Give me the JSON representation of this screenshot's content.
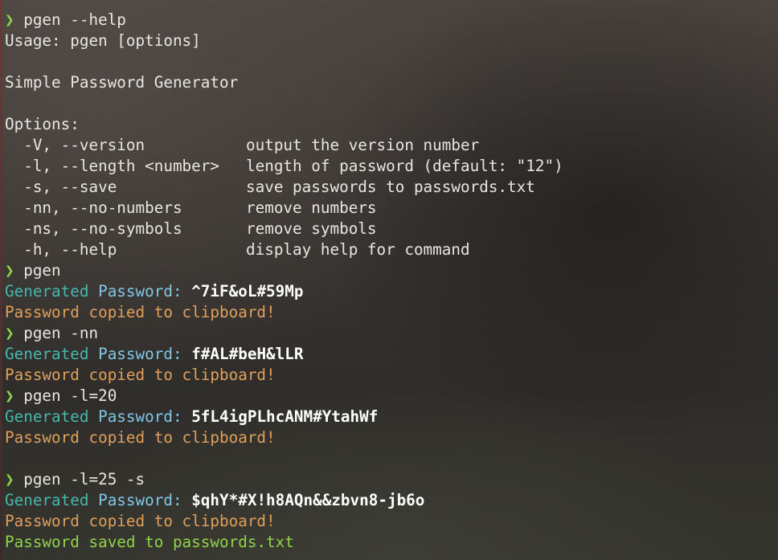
{
  "terminal": {
    "prompt_symbol": "❯",
    "help": {
      "command": "pgen --help",
      "usage": "Usage: pgen [options]",
      "description": "Simple Password Generator",
      "options_header": "Options:",
      "options": [
        {
          "flag": "  -V, --version",
          "desc": "output the version number"
        },
        {
          "flag": "  -l, --length <number>",
          "desc": "length of password (default: \"12\")"
        },
        {
          "flag": "  -s, --save",
          "desc": "save passwords to passwords.txt"
        },
        {
          "flag": "  -nn, --no-numbers",
          "desc": "remove numbers"
        },
        {
          "flag": "  -ns, --no-symbols",
          "desc": "remove symbols"
        },
        {
          "flag": "  -h, --help",
          "desc": "display help for command"
        }
      ]
    },
    "runs": [
      {
        "command": "pgen",
        "generated_label_1": "Generated",
        "generated_label_2": "Password:",
        "password": "^7iF&oL#59Mp",
        "copied": "Password copied to clipboard!"
      },
      {
        "command": "pgen -nn",
        "generated_label_1": "Generated",
        "generated_label_2": "Password:",
        "password": "f#AL#beH&lLR",
        "copied": "Password copied to clipboard!"
      },
      {
        "command": "pgen -l=20",
        "generated_label_1": "Generated",
        "generated_label_2": "Password:",
        "password": "5fL4igPLhcANM#YtahWf",
        "copied": "Password copied to clipboard!"
      },
      {
        "command": "pgen -l=25 -s",
        "generated_label_1": "Generated",
        "generated_label_2": "Password:",
        "password": "$qhY*#X!h8AQn&&zbvn8-jb6o",
        "copied": "Password copied to clipboard!",
        "saved": "Password saved to passwords.txt"
      }
    ]
  },
  "colors": {
    "prompt": "#8fd448",
    "generated": "#46b8ae",
    "password_label": "#7fc8e8",
    "copied": "#e0a05c",
    "saved": "#8fd448"
  }
}
